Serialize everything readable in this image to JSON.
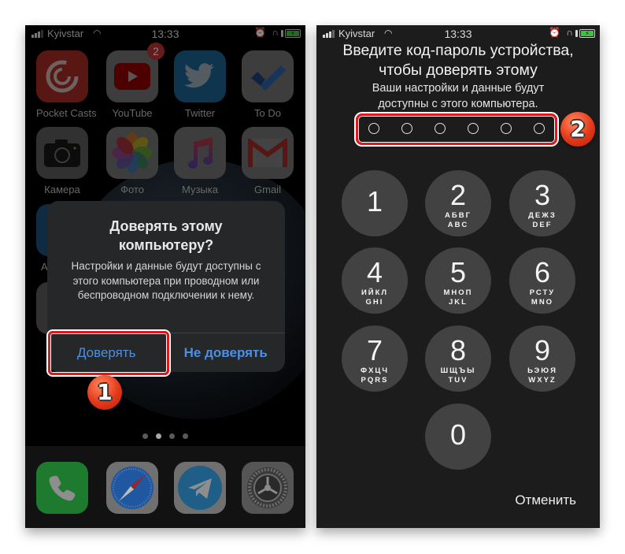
{
  "status_bar": {
    "carrier": "Kyivstar",
    "time": "13:33",
    "icons": [
      "signal-icon",
      "wifi-icon",
      "alarm-icon",
      "headphones-icon",
      "orientation-lock-icon",
      "battery-charging-icon"
    ]
  },
  "home_screen": {
    "apps": [
      {
        "label": "Pocket Casts",
        "icon": "pocket-casts-icon",
        "color": "#a12a22"
      },
      {
        "label": "YouTube",
        "icon": "youtube-icon",
        "color": "#707070",
        "badge": "2"
      },
      {
        "label": "Twitter",
        "icon": "twitter-icon",
        "color": "#1a5f8f"
      },
      {
        "label": "To Do",
        "icon": "todo-icon",
        "color": "#707070"
      },
      {
        "label": "Камера",
        "icon": "camera-icon",
        "color": "#5a5a5a"
      },
      {
        "label": "Фото",
        "icon": "photos-icon",
        "color": "#707070"
      },
      {
        "label": "Музыка",
        "icon": "music-icon",
        "color": "#707070"
      },
      {
        "label": "Gmail",
        "icon": "gmail-icon",
        "color": "#707070"
      },
      {
        "label": "A",
        "icon": "partial-app-icon",
        "color": "#1d4f78"
      }
    ],
    "page_dots": {
      "count": 4,
      "active": 2
    },
    "dock": [
      {
        "icon": "phone-icon",
        "color": "#1e7a2e"
      },
      {
        "icon": "safari-icon",
        "color": "#707070"
      },
      {
        "icon": "telegram-icon",
        "color": "#707070"
      },
      {
        "icon": "settings-icon",
        "color": "#555555"
      }
    ]
  },
  "trust_dialog": {
    "title": "Доверять этому компьютеру?",
    "message": "Настройки и данные будут доступны с этого компьютера при проводном или беспроводном подключении к нему.",
    "trust_button": "Доверять",
    "dont_trust_button": "Не доверять"
  },
  "passcode_screen": {
    "title": "Введите код-пароль устройства, чтобы доверять этому",
    "subtitle": "Ваши настройки и данные будут доступны с этого компьютера.",
    "passcode_length": 6,
    "keys": [
      {
        "digit": "1",
        "cyr": "",
        "lat": ""
      },
      {
        "digit": "2",
        "cyr": "АБВГ",
        "lat": "ABC"
      },
      {
        "digit": "3",
        "cyr": "ДЕЖЗ",
        "lat": "DEF"
      },
      {
        "digit": "4",
        "cyr": "ИЙКЛ",
        "lat": "GHI"
      },
      {
        "digit": "5",
        "cyr": "МНОП",
        "lat": "JKL"
      },
      {
        "digit": "6",
        "cyr": "РСТУ",
        "lat": "MNO"
      },
      {
        "digit": "7",
        "cyr": "ФХЦЧ",
        "lat": "PQRS"
      },
      {
        "digit": "8",
        "cyr": "ШЩЪЫ",
        "lat": "TUV"
      },
      {
        "digit": "9",
        "cyr": "ЬЭЮЯ",
        "lat": "WXYZ"
      },
      {
        "digit": "0",
        "cyr": "",
        "lat": ""
      }
    ],
    "cancel": "Отменить"
  },
  "annotations": {
    "step1": "1",
    "step2": "2",
    "highlight_color": "#e0181e"
  }
}
